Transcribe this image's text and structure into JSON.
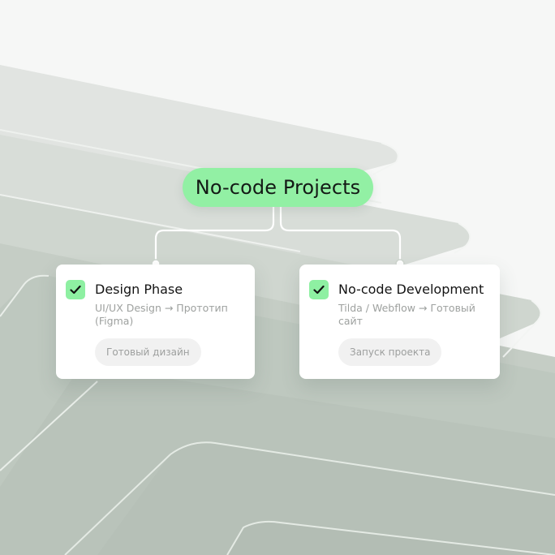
{
  "diagram": {
    "root": {
      "label": "No-code Projects"
    },
    "nodes": [
      {
        "title": "Design Phase",
        "subtitle": "UI/UX Design → Прототип (Figma)",
        "tag": "Готовый дизайн",
        "checked": true
      },
      {
        "title": "No-code Development",
        "subtitle": "Tilda / Webflow → Готовый сайт",
        "tag": "Запуск проекта",
        "checked": true
      }
    ]
  },
  "colors": {
    "accent_green": "#92f0a4",
    "card_background": "#ffffff",
    "connector": "#ffffff",
    "backdrop": "#c3ccc3"
  }
}
